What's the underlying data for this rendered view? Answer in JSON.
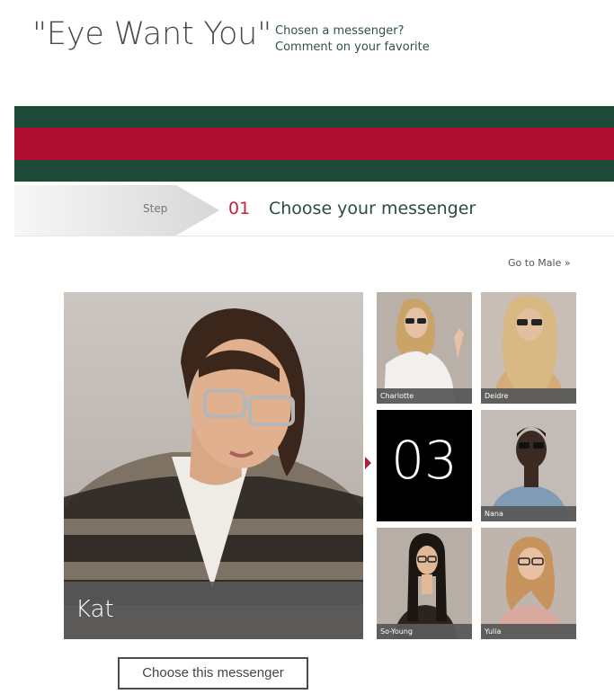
{
  "header": {
    "title": "\"Eye Want You\"",
    "subtitle_line1": "Chosen a messenger?",
    "subtitle_line2": "Comment on your favorite"
  },
  "stripes": {
    "green": "#1d4a36",
    "red": "#b00d33"
  },
  "step": {
    "label": "Step",
    "number": "01",
    "title": "Choose your messenger"
  },
  "nav": {
    "male_link": "Go to Male »"
  },
  "featured": {
    "name": "Kat"
  },
  "thumbnails": [
    {
      "name": "Charlotte"
    },
    {
      "name": "Deidre"
    },
    {
      "number": "03"
    },
    {
      "name": "Nana"
    },
    {
      "name": "So-Young"
    },
    {
      "name": "Yulia"
    }
  ],
  "actions": {
    "choose_label": "Choose this messenger"
  }
}
